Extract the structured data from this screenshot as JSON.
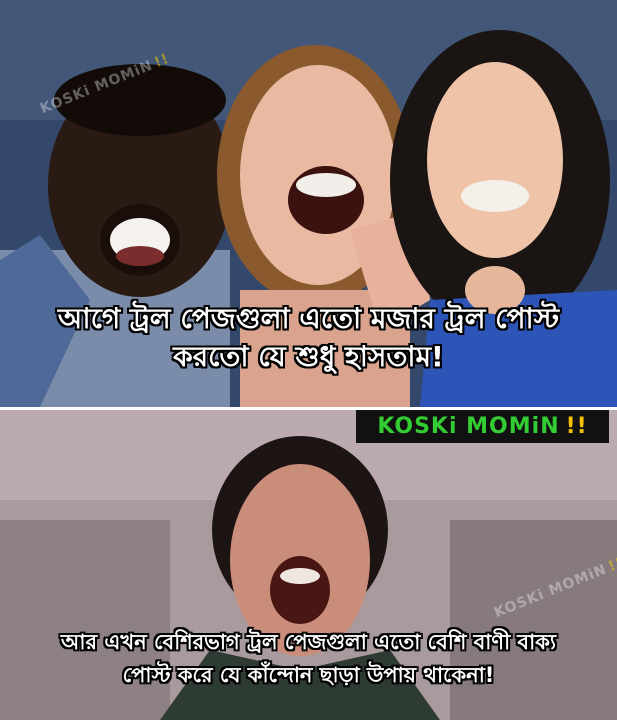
{
  "top_panel": {
    "caption_line1": "আগে ট্রল পেজগুলা এতো মজার ট্রল পোস্ট",
    "caption_line2": "করতো যে শুধু হাসতাম!"
  },
  "bottom_panel": {
    "caption_line1": "আর এখন বেশিরভাগ ট্রল পেজগুলা এতো বেশি বাণী বাক্য",
    "caption_line2": "পোস্ট করে যে কাঁন্দোন ছাড়া উপায় থাকেনা!"
  },
  "logo": {
    "text": "KOSKi MOMiN",
    "suffix": "!!"
  },
  "watermark": {
    "text": "KOSKi MOMiN",
    "suffix": "!!"
  },
  "colors": {
    "caption_text": "#ffffff",
    "caption_outline": "#000000",
    "logo_green": "#33cc33",
    "logo_yellow": "#f2c200"
  }
}
